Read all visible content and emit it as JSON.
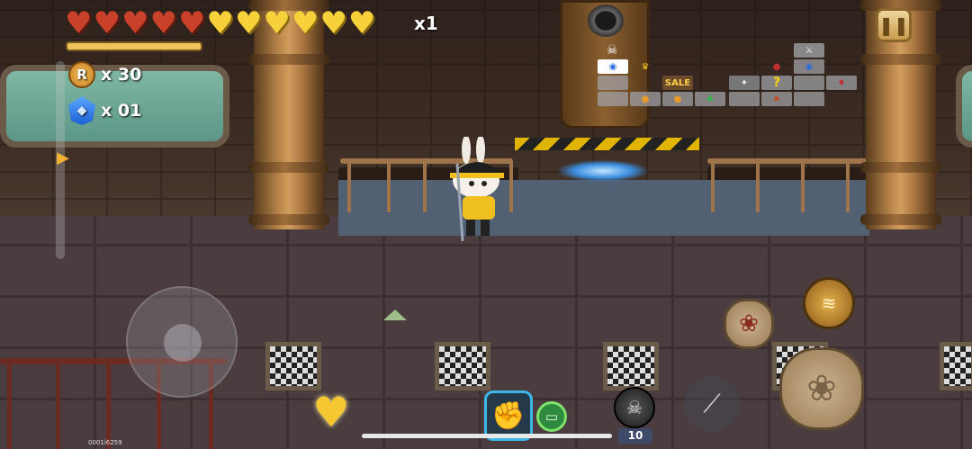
{
  "hud": {
    "hearts": [
      "red",
      "red",
      "red",
      "red",
      "red",
      "gold",
      "gold",
      "gold",
      "gold",
      "gold",
      "gold"
    ],
    "multiplier": "x1",
    "coins": {
      "icon": "coin-icon",
      "glyph": "R",
      "value": "x 30"
    },
    "gems": {
      "icon": "gem-icon",
      "value": "x 01"
    },
    "pause_glyph": "❚❚"
  },
  "minimap": {
    "sale_label": "SALE",
    "mystery_label": "?"
  },
  "controls": {
    "bomb_count": "10",
    "build_id": "0001i6259"
  },
  "colors": {
    "heart_red": "#c9412a",
    "heart_gold": "#f7d13a",
    "accent": "#f1c45b"
  }
}
